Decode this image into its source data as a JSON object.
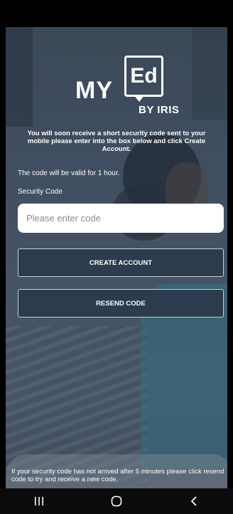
{
  "logo": {
    "my": "MY",
    "ed": "Ed",
    "by": "BY IRIS"
  },
  "intro_text": "You will soon receive a short security code sent to your mobile please enter into the box below and click Create Account.",
  "validity_text": "The code will be valid for 1 hour.",
  "security_code": {
    "label": "Security Code",
    "placeholder": "Please enter code",
    "value": ""
  },
  "buttons": {
    "create_account": "CREATE ACCOUNT",
    "resend_code": "RESEND CODE"
  },
  "footer_note": "If your security code has not arrived after 5 minutes please click resend code to try and receive a new code.",
  "navigation": {
    "recents_icon": "recents-icon",
    "home_icon": "home-icon",
    "back_icon": "back-icon"
  },
  "colors": {
    "button_bg": "#2c3b4d",
    "button_border": "#c9d0d8",
    "input_bg": "#ffffff",
    "text": "#ffffff",
    "nav_bar": "#0b0b0b"
  }
}
